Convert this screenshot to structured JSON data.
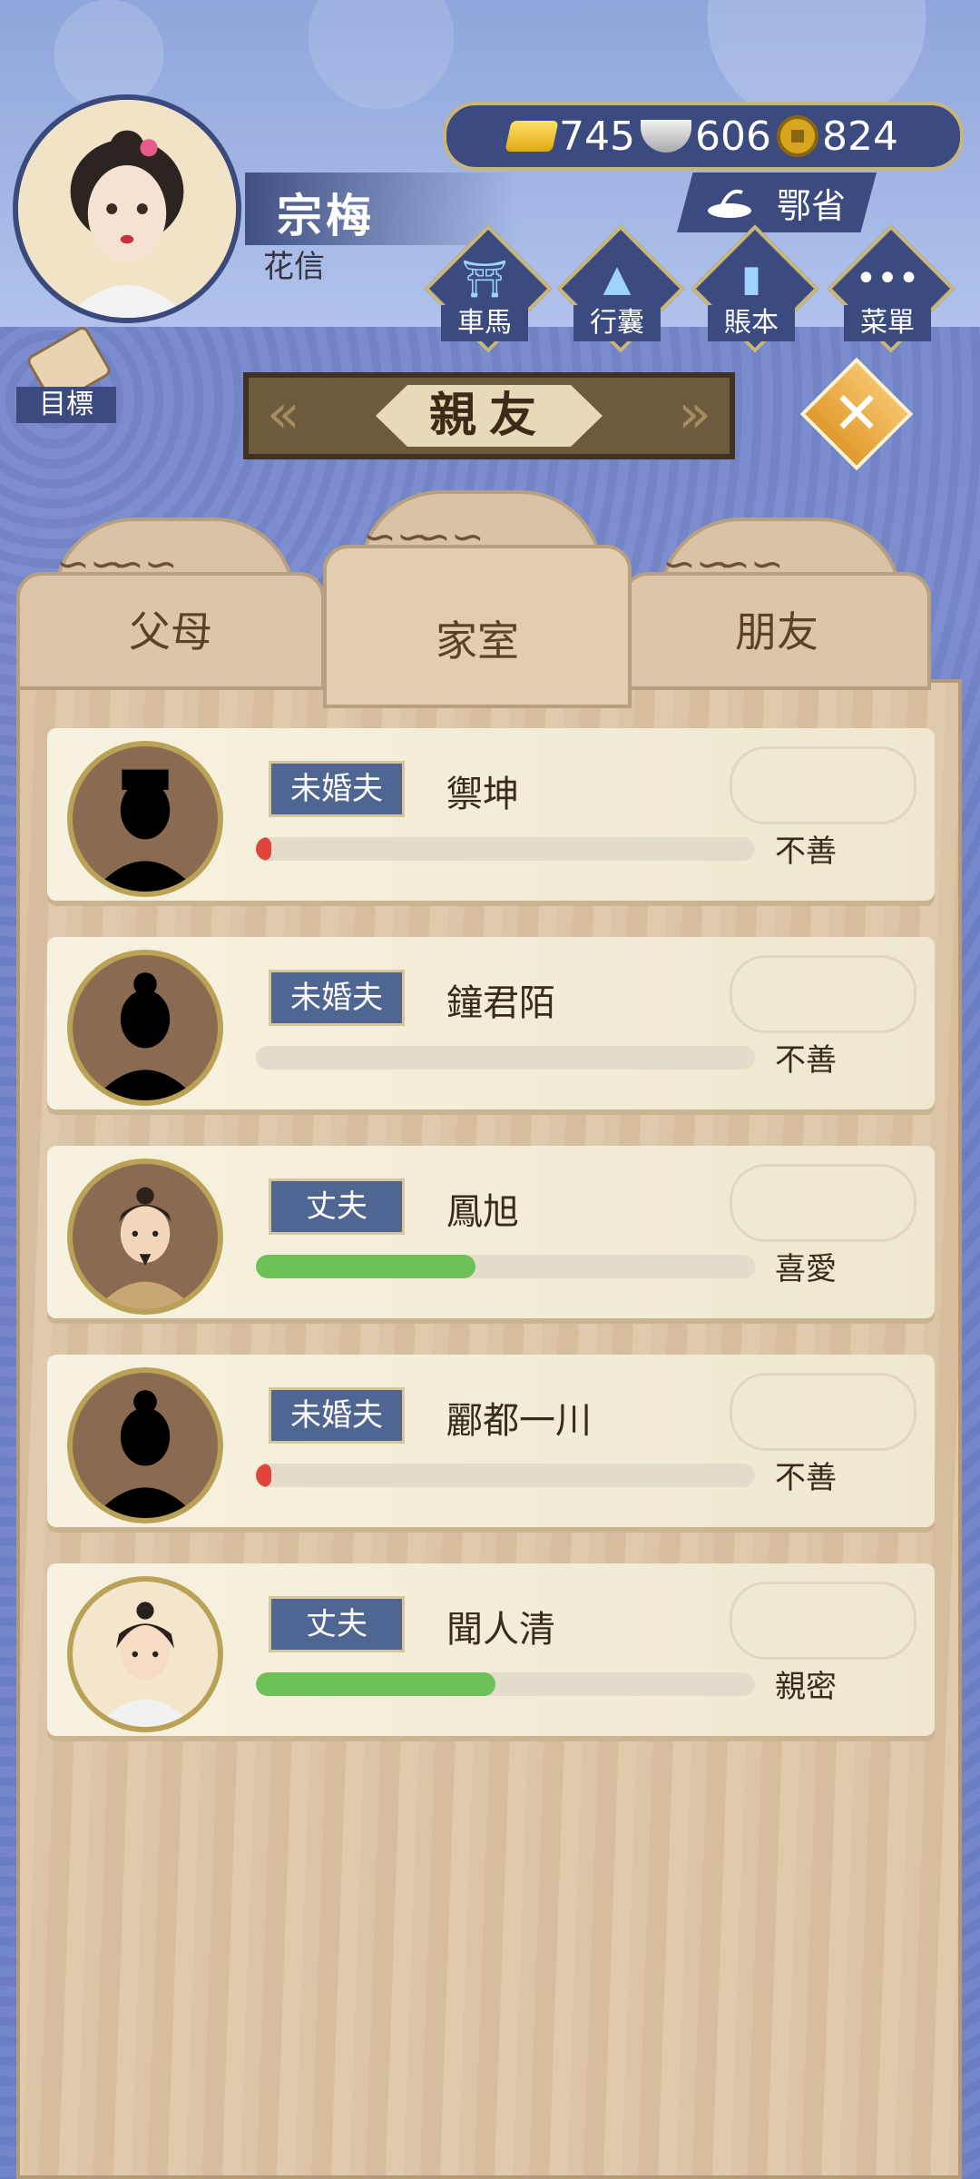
{
  "player": {
    "name": "宗梅",
    "subtitle": "花信"
  },
  "currency": [
    {
      "icon": "gold-ingot-icon",
      "value": "745"
    },
    {
      "icon": "silver-ingot-icon",
      "value": "606"
    },
    {
      "icon": "copper-coin-icon",
      "value": "824"
    }
  ],
  "province": {
    "label": "鄂省"
  },
  "menu": [
    {
      "name": "carriage",
      "label": "車馬"
    },
    {
      "name": "luggage",
      "label": "行囊"
    },
    {
      "name": "ledger",
      "label": "賬本"
    },
    {
      "name": "menu",
      "label": "菜單"
    }
  ],
  "goal": {
    "label": "目標"
  },
  "title": "親友",
  "tabs": [
    {
      "label": "父母",
      "active": false
    },
    {
      "label": "家室",
      "active": true
    },
    {
      "label": "朋友",
      "active": false
    }
  ],
  "relations": [
    {
      "role": "未婚夫",
      "name": "禦坤",
      "status": "不善",
      "affinity": 0.02,
      "color": "#e0453a",
      "portrait": "silhouette"
    },
    {
      "role": "未婚夫",
      "name": "鐘君陌",
      "status": "不善",
      "affinity": 0.0,
      "color": "#e0453a",
      "portrait": "silhouette-bun"
    },
    {
      "role": "丈夫",
      "name": "鳳旭",
      "status": "喜愛",
      "affinity": 0.44,
      "color": "#6cc257",
      "portrait": "man-bearded"
    },
    {
      "role": "未婚夫",
      "name": "酈都一川",
      "status": "不善",
      "affinity": 0.03,
      "color": "#e0453a",
      "portrait": "silhouette-bun"
    },
    {
      "role": "丈夫",
      "name": "聞人清",
      "status": "親密",
      "affinity": 0.48,
      "color": "#6cc257",
      "portrait": "young-man"
    }
  ]
}
